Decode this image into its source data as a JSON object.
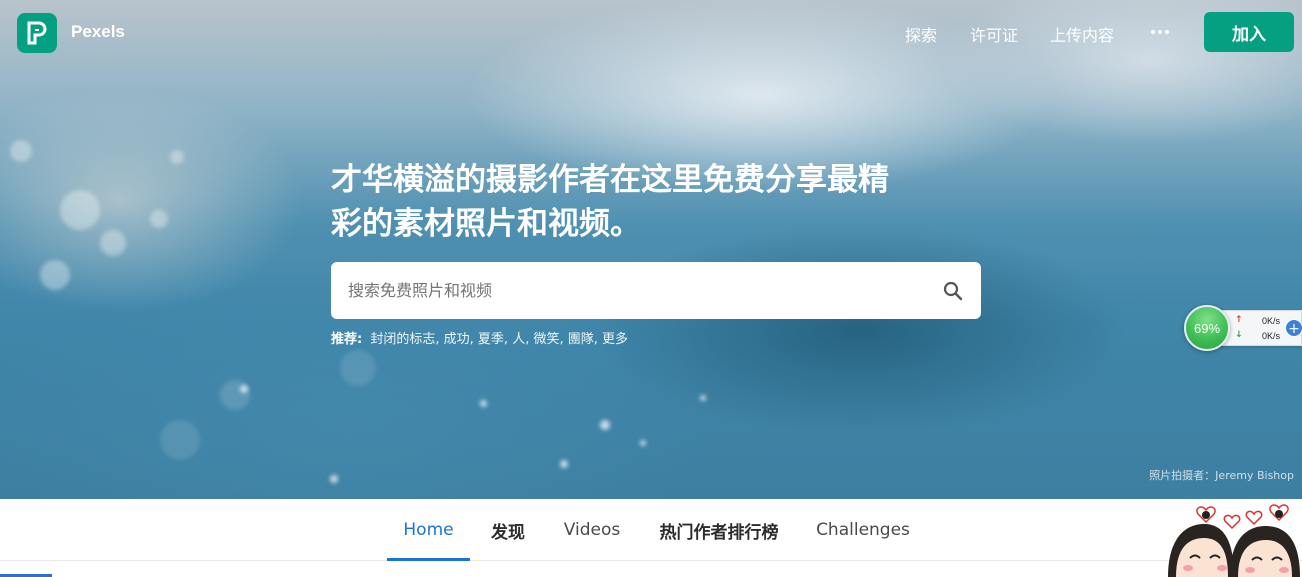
{
  "header": {
    "brand": "Pexels",
    "nav": [
      "探索",
      "许可证",
      "上传内容"
    ],
    "join_label": "加入"
  },
  "hero": {
    "headline_line1": "才华横溢的摄影作者在这里免费分享最精",
    "headline_line2": "彩的素材照片和视频。",
    "search_placeholder": "搜索免费照片和视频",
    "suggest_label": "推荐:",
    "suggestions": [
      "封闭的标志",
      "成功",
      "夏季",
      "人",
      "微笑",
      "團隊",
      "更多"
    ],
    "credit": "照片拍摄者：Jeremy Bishop"
  },
  "net_widget": {
    "percent": "69%",
    "upload": "0K/s",
    "download": "0K/s",
    "plus": "+"
  },
  "tabs": {
    "items": [
      "Home",
      "发现",
      "Videos",
      "热门作者排行榜",
      "Challenges"
    ],
    "active": "Home"
  },
  "colors": {
    "brand_green": "#05a081",
    "tab_active_blue": "#1a73d6",
    "gauge_green": "#3fbf55"
  },
  "icons": [
    "pexels-logo-icon",
    "more-dots-icon",
    "search-icon",
    "upload-arrow-icon",
    "download-arrow-icon",
    "plus-icon"
  ]
}
